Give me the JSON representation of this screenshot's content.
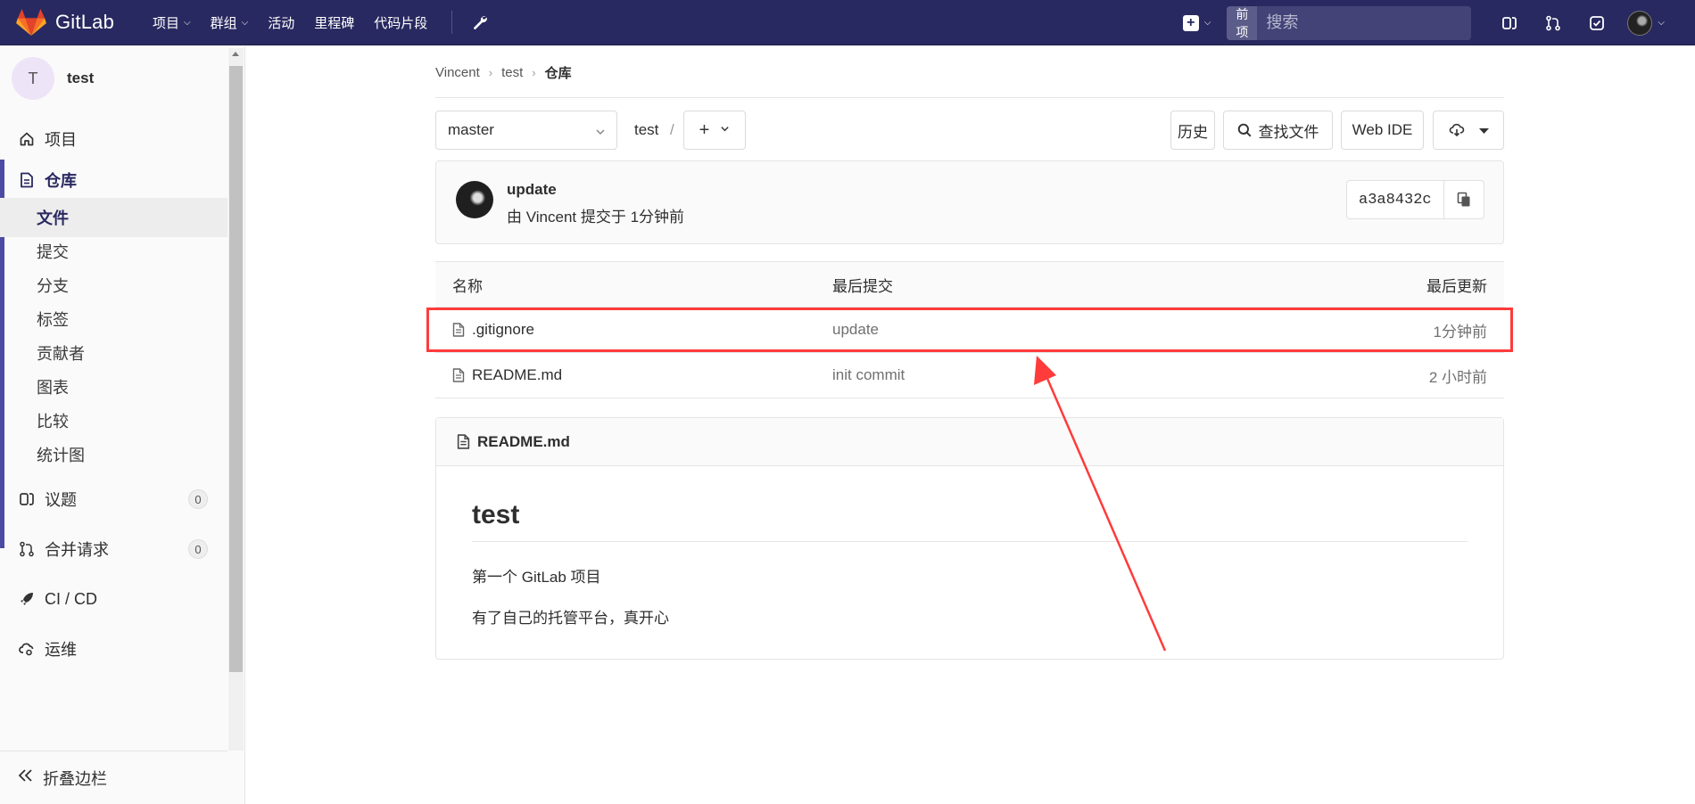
{
  "navbar": {
    "brand": "GitLab",
    "items": [
      {
        "label": "项目",
        "has_dropdown": true
      },
      {
        "label": "群组",
        "has_dropdown": true
      },
      {
        "label": "活动",
        "has_dropdown": false
      },
      {
        "label": "里程碑",
        "has_dropdown": false
      },
      {
        "label": "代码片段",
        "has_dropdown": false
      }
    ],
    "search_scope": "当前项目",
    "search_placeholder": "搜索"
  },
  "sidebar": {
    "project_initial": "T",
    "project_name": "test",
    "items": {
      "project": "项目",
      "repository": "仓库",
      "issues": "议题",
      "issues_count": "0",
      "merge_requests": "合并请求",
      "merge_requests_count": "0",
      "cicd": "CI / CD",
      "operations": "运维"
    },
    "repo_sub": [
      "文件",
      "提交",
      "分支",
      "标签",
      "贡献者",
      "图表",
      "比较",
      "统计图"
    ],
    "collapse": "折叠边栏"
  },
  "breadcrumb": [
    "Vincent",
    "test",
    "仓库"
  ],
  "toolbar": {
    "branch": "master",
    "path": "test",
    "slash": "/",
    "history": "历史",
    "find_file": "查找文件",
    "web_ide": "Web IDE"
  },
  "last_commit": {
    "title": "update",
    "meta": "由 Vincent 提交于 1分钟前",
    "sha": "a3a8432c"
  },
  "files": {
    "headers": {
      "name": "名称",
      "last_commit": "最后提交",
      "last_update": "最后更新"
    },
    "rows": [
      {
        "name": ".gitignore",
        "commit": "update",
        "date": "1分钟前"
      },
      {
        "name": "README.md",
        "commit": "init commit",
        "date": "2 小时前"
      }
    ]
  },
  "readme": {
    "filename": "README.md",
    "heading": "test",
    "lines": [
      "第一个 GitLab 项目",
      "有了自己的托管平台，真开心"
    ]
  },
  "colors": {
    "navbar": "#292961",
    "accent": "#4b4ba3",
    "annotation": "#ff3b3b"
  }
}
